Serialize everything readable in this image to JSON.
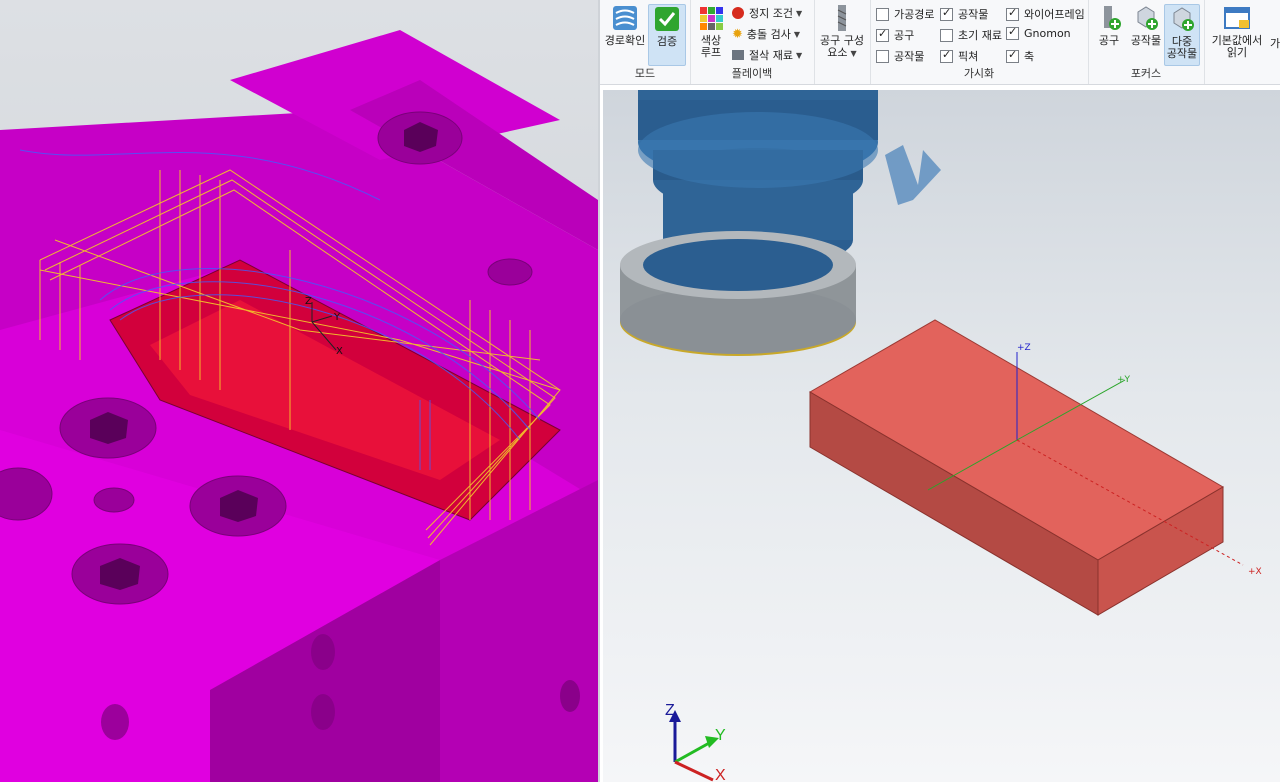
{
  "ribbon": {
    "mode": {
      "label": "모드",
      "path_button": "경로확인",
      "verify_button": "검증"
    },
    "playback": {
      "label": "플레이백",
      "color_loop_line1": "색상",
      "color_loop_line2": "루프",
      "stop_conditions": "정지 조건",
      "collision_check": "충돌 검사",
      "cut_material": "절삭 재료"
    },
    "tool_components": {
      "line1": "공구 구성",
      "line2": "요소"
    },
    "visibility": {
      "label": "가시화",
      "items": [
        {
          "label": "가공경로",
          "checked": false
        },
        {
          "label": "공구",
          "checked": true
        },
        {
          "label": "공작물",
          "checked": false
        },
        {
          "label": "공작물",
          "checked": true
        },
        {
          "label": "초기 재료",
          "checked": false
        },
        {
          "label": "픽쳐",
          "checked": true
        },
        {
          "label": "와이어프레임",
          "checked": true
        },
        {
          "label": "Gnomon",
          "checked": true
        },
        {
          "label": "축",
          "checked": true
        }
      ]
    },
    "focus": {
      "label": "포커스",
      "tool": "공구",
      "workpiece": "공작물",
      "multi_line1": "다중",
      "multi_line2": "공작물"
    },
    "read_defaults": {
      "line1": "기본값에서",
      "line2": "읽기",
      "partial": "가"
    }
  },
  "viewport_axes": {
    "x": "+X",
    "y": "+Y",
    "z": "+Z",
    "gnomon_x": "X",
    "gnomon_y": "Y",
    "gnomon_z": "Z"
  },
  "left_axes": {
    "x": "X",
    "y": "Y",
    "z": "Z"
  },
  "colors": {
    "fixture": "#d400d4",
    "stock": "#e2635c",
    "tool_holder": "#2f6496",
    "toolpath": "#f3c12b"
  }
}
